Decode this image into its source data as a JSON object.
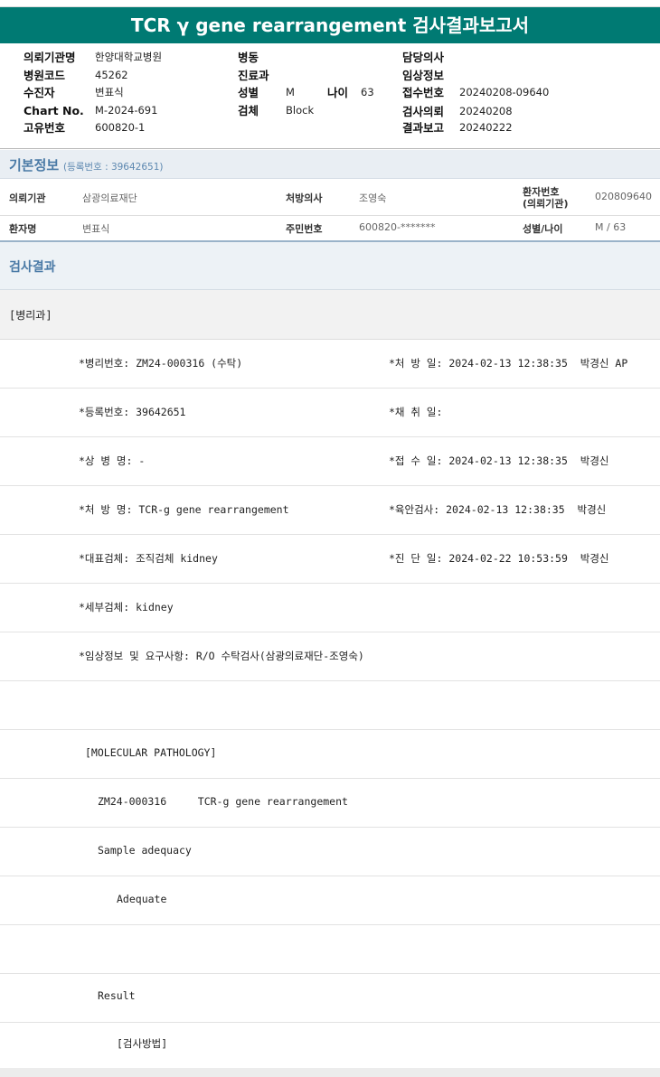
{
  "title": "TCR γ gene rearrangement 검사결과보고서",
  "header": {
    "col1": [
      {
        "label": "의뢰기관명",
        "value": "한양대학교병원"
      },
      {
        "label": "병원코드",
        "value": "45262"
      },
      {
        "label": "수진자",
        "value": "변표식"
      },
      {
        "label": "Chart No.",
        "value": "M-2024-691"
      },
      {
        "label": "고유번호",
        "value": "600820-1"
      }
    ],
    "col2": [
      {
        "label": "병동",
        "value": ""
      },
      {
        "label": "진료과",
        "value": ""
      },
      {
        "label": "성별",
        "value": "M"
      },
      {
        "label": "검체",
        "value": "Block"
      }
    ],
    "age": {
      "label": "나이",
      "value": "63"
    },
    "col3": [
      {
        "label": "담당의사",
        "value": ""
      },
      {
        "label": "임상정보",
        "value": ""
      },
      {
        "label": "접수번호",
        "value": "20240208-09640"
      },
      {
        "label": "검사의뢰",
        "value": "20240208"
      },
      {
        "label": "결과보고",
        "value": "20240222"
      }
    ]
  },
  "basic": {
    "title": "기본정보",
    "sub": "(등록번호 : 39642651)",
    "row1": {
      "l1": "의뢰기관",
      "v1": "삼광의료재단",
      "l2": "처방의사",
      "v2": "조영숙",
      "l3a": "환자번호",
      "l3b": "(의뢰기관)",
      "v3": "020809640"
    },
    "row2": {
      "l1": "환자명",
      "v1": "변표식",
      "l2": "주민번호",
      "v2": "600820-*******",
      "l3": "성별/나이",
      "v3": "M / 63"
    }
  },
  "results": {
    "title": "검사결과",
    "dept": "[병리과]",
    "lines": [
      {
        "left": "*병리번호: ZM24-000316 (수탁)",
        "right": "*처 방 일: 2024-02-13 12:38:35  박경신 AP"
      },
      {
        "left": "*등록번호: 39642651",
        "right": "*채 취 일:"
      },
      {
        "left": "*상 병 명: -",
        "right": "*접 수 일: 2024-02-13 12:38:35  박경신"
      },
      {
        "left": "*처 방 명: TCR-g gene rearrangement",
        "right": "*육안검사: 2024-02-13 12:38:35  박경신"
      },
      {
        "left": "*대표검체: 조직검체 kidney",
        "right": "*진 단 일: 2024-02-22 10:53:59  박경신"
      },
      {
        "left": "*세부검체: kidney",
        "right": ""
      },
      {
        "left": "*임상정보 및 요구사항: R/O 수탁검사(삼광의료재단-조영숙)",
        "right": ""
      }
    ],
    "report": [
      {
        "text": "[MOLECULAR PATHOLOGY]"
      },
      {
        "text": "ZM24-000316     TCR-g gene rearrangement"
      },
      {
        "text": "Sample adequacy"
      },
      {
        "text": "Adequate"
      },
      {
        "text": ""
      },
      {
        "text": "Result"
      },
      {
        "text": "[검사방법]"
      }
    ]
  }
}
